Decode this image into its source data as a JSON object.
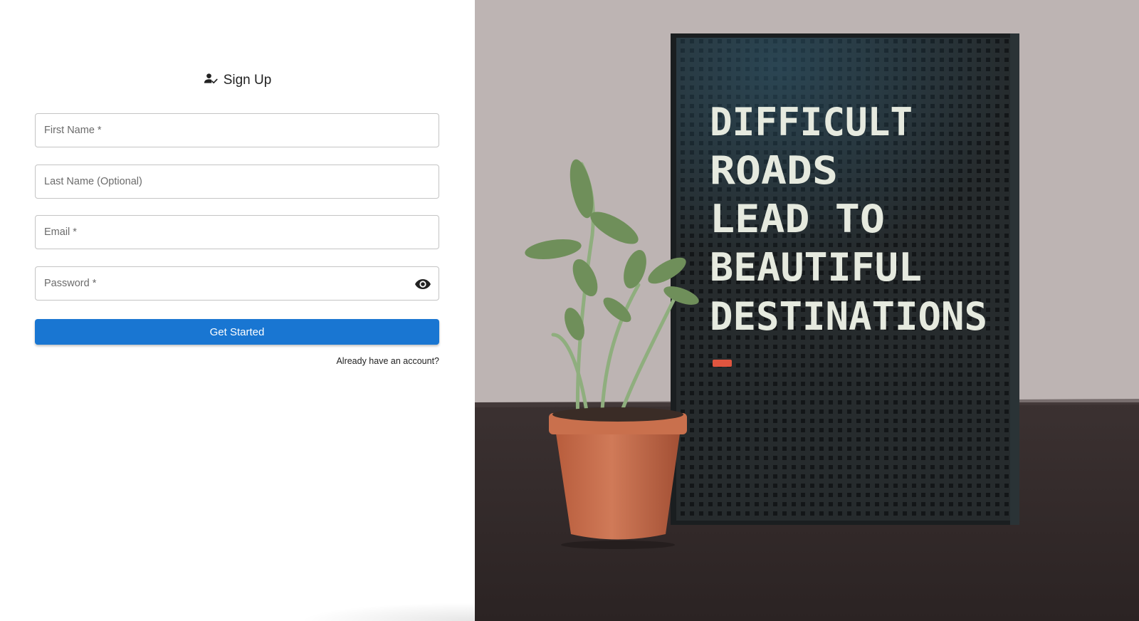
{
  "title": "Sign Up",
  "fields": {
    "first_name": {
      "placeholder": "First Name *",
      "value": ""
    },
    "last_name": {
      "placeholder": "Last Name (Optional)",
      "value": ""
    },
    "email": {
      "placeholder": "Email *",
      "value": ""
    },
    "password": {
      "placeholder": "Password *",
      "value": ""
    }
  },
  "buttons": {
    "submit_label": "Get Started"
  },
  "links": {
    "signin_label": "Already have an account?"
  },
  "icons": {
    "title_icon": "person-check-icon",
    "password_toggle": "eye-icon"
  },
  "hero": {
    "letterboard_lines": [
      "DIFFICULT",
      "ROADS",
      "LEAD TO",
      "BEAUTIFUL",
      "DESTINATIONS"
    ]
  },
  "colors": {
    "primary": "#1976d2",
    "border": "#c4c4c4",
    "letter": "#e6eadf",
    "board": "#24292b",
    "pot": "#c76e4c",
    "accent_tile": "#e0553f"
  }
}
